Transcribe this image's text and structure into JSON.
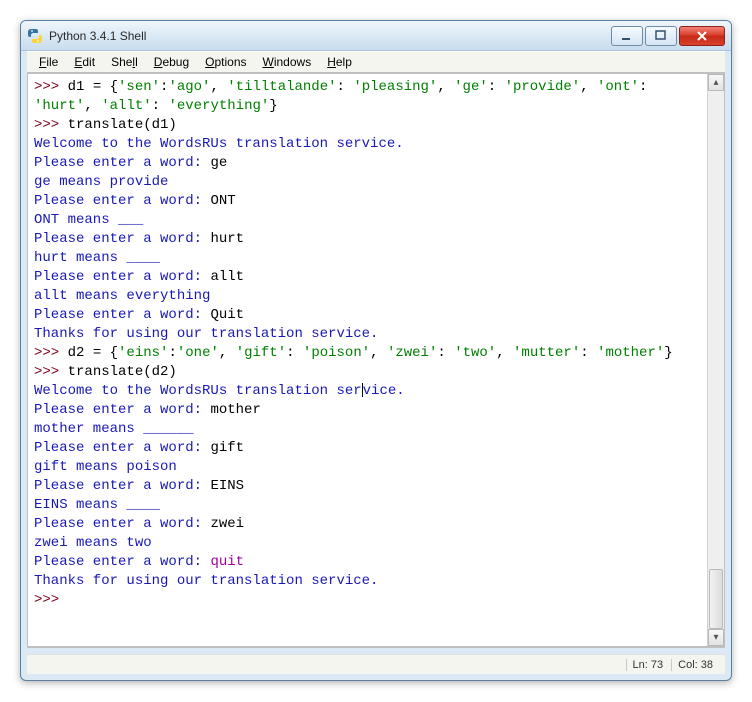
{
  "window": {
    "title": "Python 3.4.1 Shell"
  },
  "menu": {
    "file": "File",
    "edit": "Edit",
    "shell": "Shell",
    "debug": "Debug",
    "options": "Options",
    "windows": "Windows",
    "help": "Help"
  },
  "status": {
    "ln": "Ln: 73",
    "col": "Col: 38"
  },
  "colors": {
    "prompt": "#7a0016",
    "string": "#008000",
    "output": "#1818b8",
    "keyword": "#0a0a88"
  },
  "session": {
    "lines": [
      {
        "t": "cmd",
        "prompt": ">>> ",
        "plain": "d1 = {",
        "strs": [
          "'sen'",
          "'ago'",
          "'tilltalande'",
          "'pleasing'",
          "'ge'",
          "'provide'",
          "'ont'",
          "'hurt'",
          "'allt'",
          "'everything'"
        ],
        "render": "d1_assign"
      },
      {
        "t": "cmd",
        "prompt": ">>> ",
        "plain": "translate(d1)"
      },
      {
        "t": "out",
        "text": "Welcome to the WordsRUs translation service."
      },
      {
        "t": "inp",
        "prompt": "Please enter a word: ",
        "user": "ge"
      },
      {
        "t": "out",
        "text": "ge means provide"
      },
      {
        "t": "inp",
        "prompt": "Please enter a word: ",
        "user": "ONT"
      },
      {
        "t": "out",
        "text": "ONT means ___"
      },
      {
        "t": "inp",
        "prompt": "Please enter a word: ",
        "user": "hurt"
      },
      {
        "t": "out",
        "text": "hurt means ____"
      },
      {
        "t": "inp",
        "prompt": "Please enter a word: ",
        "user": "allt"
      },
      {
        "t": "out",
        "text": "allt means everything"
      },
      {
        "t": "inp",
        "prompt": "Please enter a word: ",
        "user": "Quit"
      },
      {
        "t": "out",
        "text": "Thanks for using our translation service."
      },
      {
        "t": "cmd",
        "prompt": ">>> ",
        "plain": "d2 = {",
        "strs": [
          "'eins'",
          "'one'",
          "'gift'",
          "'poison'",
          "'zwei'",
          "'two'",
          "'mutter'",
          "'mother'"
        ],
        "render": "d2_assign"
      },
      {
        "t": "cmd",
        "prompt": ">>> ",
        "plain": "translate(d2)"
      },
      {
        "t": "out",
        "text": "Welcome to the WordsRUs translation service.",
        "caret_at": 39
      },
      {
        "t": "inp",
        "prompt": "Please enter a word: ",
        "user": "mother"
      },
      {
        "t": "out",
        "text": "mother means ______"
      },
      {
        "t": "inp",
        "prompt": "Please enter a word: ",
        "user": "gift"
      },
      {
        "t": "out",
        "text": "gift means poison"
      },
      {
        "t": "inp",
        "prompt": "Please enter a word: ",
        "user": "EINS"
      },
      {
        "t": "out",
        "text": "EINS means ____"
      },
      {
        "t": "inp",
        "prompt": "Please enter a word: ",
        "user": "zwei"
      },
      {
        "t": "out",
        "text": "zwei means two"
      },
      {
        "t": "inp",
        "prompt": "Please enter a word: ",
        "user": "quit",
        "user_color": "err"
      },
      {
        "t": "out",
        "text": "Thanks for using our translation service."
      },
      {
        "t": "cmd",
        "prompt": ">>> ",
        "plain": ""
      }
    ]
  }
}
